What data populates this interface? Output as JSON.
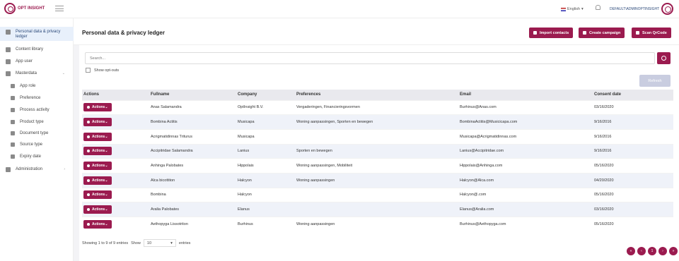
{
  "header": {
    "logo_text": "OPT INSIGHT",
    "language": "English",
    "user": "DEFAULT\\ADMINOPTINSIGHT"
  },
  "sidebar": {
    "items": [
      {
        "label": "Personal data & privacy ledger",
        "icon": "users-icon",
        "active": true
      },
      {
        "label": "Content library",
        "icon": "book-icon"
      },
      {
        "label": "App user",
        "icon": "user-icon"
      },
      {
        "label": "Masterdata",
        "icon": "cogs-icon",
        "expanded": true
      },
      {
        "label": "App role",
        "icon": "person-icon",
        "sub": true
      },
      {
        "label": "Preference",
        "icon": "thumbs-up-icon",
        "sub": true
      },
      {
        "label": "Process activity",
        "icon": "wrench-icon",
        "sub": true
      },
      {
        "label": "Product type",
        "icon": "tools-icon",
        "sub": true
      },
      {
        "label": "Document type",
        "icon": "file-icon",
        "sub": true
      },
      {
        "label": "Source type",
        "icon": "search-icon",
        "sub": true
      },
      {
        "label": "Expiry date",
        "icon": "calendar-icon",
        "sub": true
      },
      {
        "label": "Administration",
        "icon": "list-icon"
      }
    ]
  },
  "page": {
    "title": "Personal data & privacy ledger",
    "buttons": {
      "import": "Import contacts",
      "campaign": "Create campaign",
      "scan": "Scan QrCode"
    }
  },
  "search": {
    "placeholder": "Search..."
  },
  "optout_label": "Show opt-outs",
  "refresh_label": "Refresh",
  "table": {
    "columns": [
      "Actions",
      "Fullname",
      "Company",
      "Preferences",
      "Email",
      "Consent date"
    ],
    "action_label": "Actions",
    "rows": [
      [
        "Anas Salamandra",
        "OptInsight B.V.",
        "Vergaderingen, Financieringsvormen",
        "Burhinus@Anas.com",
        "03/16/2020"
      ],
      [
        "Bombina Actitis",
        "Musicapa",
        "Woning aanpassingen, Sporten en bewegen",
        "BombinaActitis@Musicicapa.com",
        "9/16/2016"
      ],
      [
        "Acrigmatidinnas Triturus",
        "Musicapa",
        "",
        "Musicapa@Acrigmatidinnas.com",
        "9/16/2016"
      ],
      [
        "Accipitridae Salamandra",
        "Lanius",
        "Sporten en bewegen",
        "Lanius@Accipitridae.com",
        "9/16/2016"
      ],
      [
        "Anhinga Palobates",
        "Hippolais",
        "Woning aanpassingen, Mobiliteit",
        "Hippolais@Anhinga.com",
        "05/16/2020"
      ],
      [
        "Alca bicottiton",
        "Halcyon",
        "Woning aanpassingen",
        "Halcyon@Alca.com",
        "04/20/2020"
      ],
      [
        "Bombina",
        "Halcyon",
        "",
        "Halcyon@.com",
        "05/16/2020"
      ],
      [
        "Aralia Palobates",
        "Elanus",
        "",
        "Elanus@Aralia.com",
        "03/16/2020"
      ],
      [
        "Aethopyga Lissotriton",
        "Burhinus",
        "Woning aanpassingen",
        "Burhinus@Aethopyga.com",
        "05/16/2020"
      ]
    ]
  },
  "footer": {
    "showing": "Showing 1 to 9 of 9 entries",
    "show_label": "Show",
    "page_size": "10",
    "entries_label": "entries"
  },
  "pager": {
    "first": "«",
    "prev": "‹",
    "current": "1",
    "next": "›",
    "last": "»"
  },
  "colors": {
    "accent": "#9b1b4f",
    "link": "#4f76b6"
  }
}
